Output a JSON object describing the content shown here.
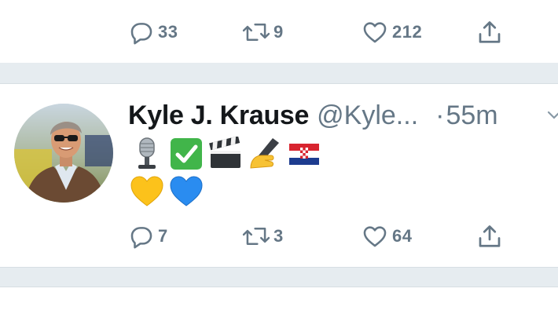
{
  "prev_tweet": {
    "replies": "33",
    "retweets": "9",
    "likes": "212"
  },
  "tweet": {
    "display_name": "Kyle J. Krause",
    "handle": "@Kyle...",
    "separator_dot": "·",
    "time": "55m",
    "bio_line1": [
      "studio-microphone",
      "check-mark-button",
      "clapper-board",
      "writing-hand",
      "flag-croatia"
    ],
    "bio_line2": [
      "yellow-heart",
      "blue-heart"
    ],
    "replies": "7",
    "retweets": "3",
    "likes": "64"
  },
  "colors": {
    "text_primary": "#14171a",
    "text_secondary": "#657786",
    "separator": "#e6ecf0"
  }
}
